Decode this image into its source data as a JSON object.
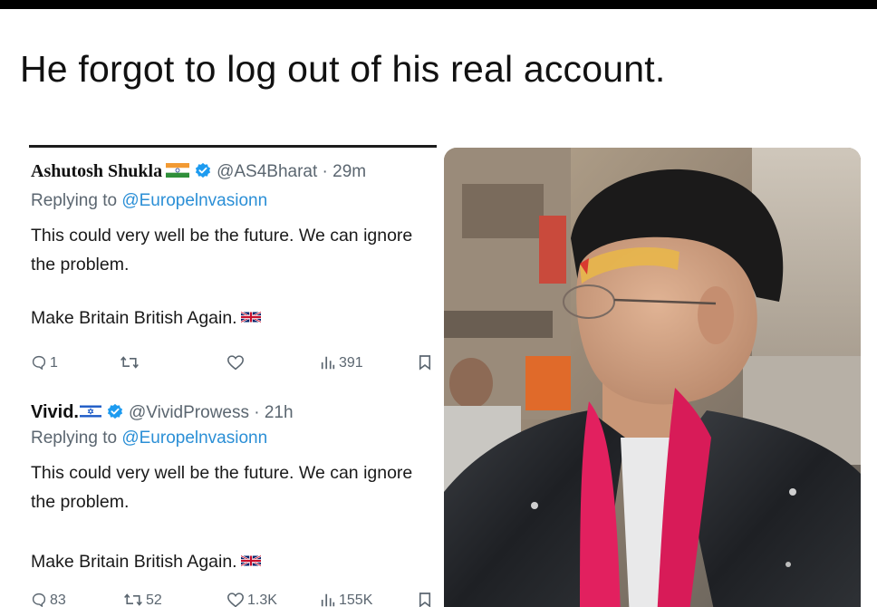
{
  "caption": "He forgot to log out of his real account.",
  "tweets": [
    {
      "name": "Ashutosh Shukla",
      "flag": "india-flag-icon",
      "handle": "@AS4Bharat · 29m",
      "replying_prefix": "Replying to ",
      "replying_to": "@Europelnvasionn",
      "text": "This could very well be the future. We can ignore the problem.",
      "text2": "Make Britain British Again.",
      "replies": "1",
      "retweets": "",
      "likes": "",
      "views": "391"
    },
    {
      "name": "Vivid.",
      "flag": "israel-flag-icon",
      "handle": "@VividProwess · 21h",
      "replying_prefix": "Replying to ",
      "replying_to": "@Europelnvasionn",
      "text": "This could very well be the future. We can ignore the problem.",
      "text2": "Make Britain British Again.",
      "replies": "83",
      "retweets": "52",
      "likes": "1.3K",
      "views": "155K"
    }
  ],
  "colors": {
    "handle_gray": "#5b6670",
    "link_blue": "#2b8fd6",
    "verified_blue": "#1d9bf0",
    "scarf_pink": "#e2205f"
  }
}
